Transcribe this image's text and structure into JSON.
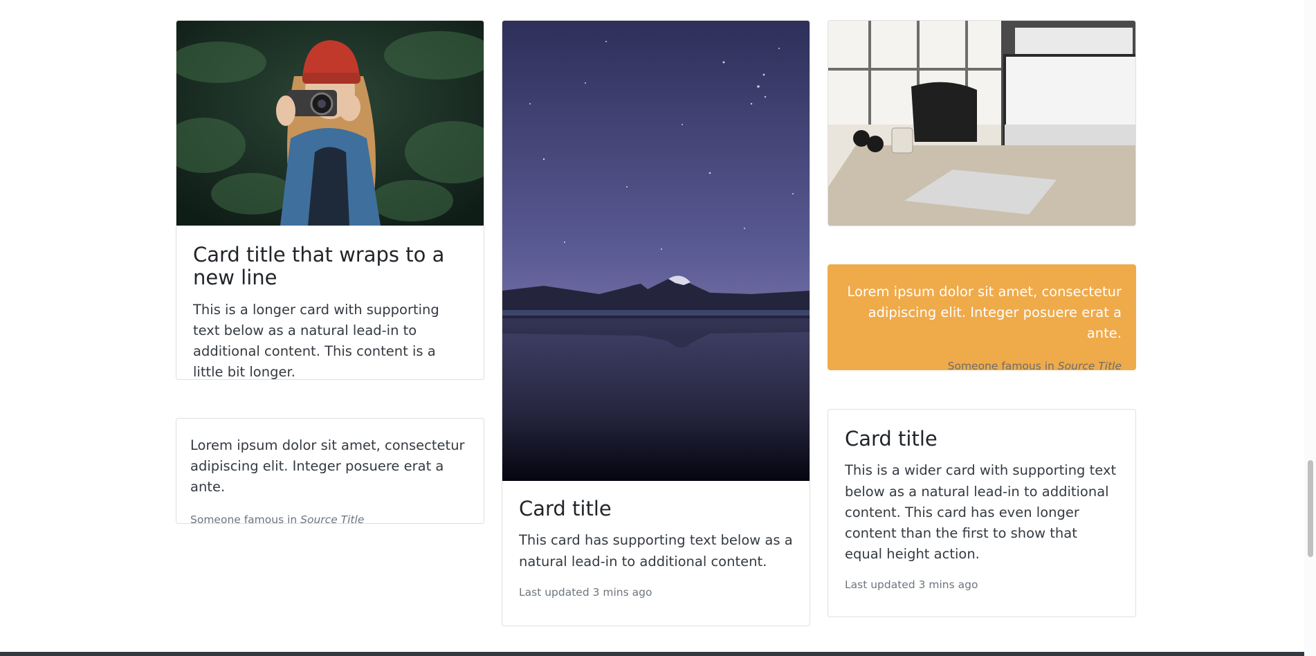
{
  "cards": {
    "photographer": {
      "image_alt": "Woman with red beanie holding a camera",
      "title": "Card title that wraps to a new line",
      "text": "This is a longer card with supporting text below as a natural lead-in to additional content. This content is a little bit longer."
    },
    "quote_left": {
      "text": "Lorem ipsum dolor sit amet, consectetur adipiscing elit. Integer posuere erat a ante.",
      "footer_prefix": "Someone famous in ",
      "footer_source": "Source Title"
    },
    "night_sky": {
      "image_alt": "Starry night sky over mountain lake",
      "title": "Card title",
      "text": "This card has supporting text below as a natural lead-in to additional content.",
      "muted": "Last updated 3 mins ago"
    },
    "desk": {
      "image_alt": "Office desk with computer, headphones and mug"
    },
    "quote_right": {
      "text": "Lorem ipsum dolor sit amet, consectetur adipiscing elit. Integer posuere erat a ante.",
      "footer_prefix": "Someone famous in ",
      "footer_source": "Source Title",
      "color": "#efaa4a"
    },
    "wide": {
      "title": "Card title",
      "text": "This is a wider card with supporting text below as a natural lead-in to additional content. This card has even longer content than the first to show that equal height action.",
      "muted": "Last updated 3 mins ago"
    }
  }
}
